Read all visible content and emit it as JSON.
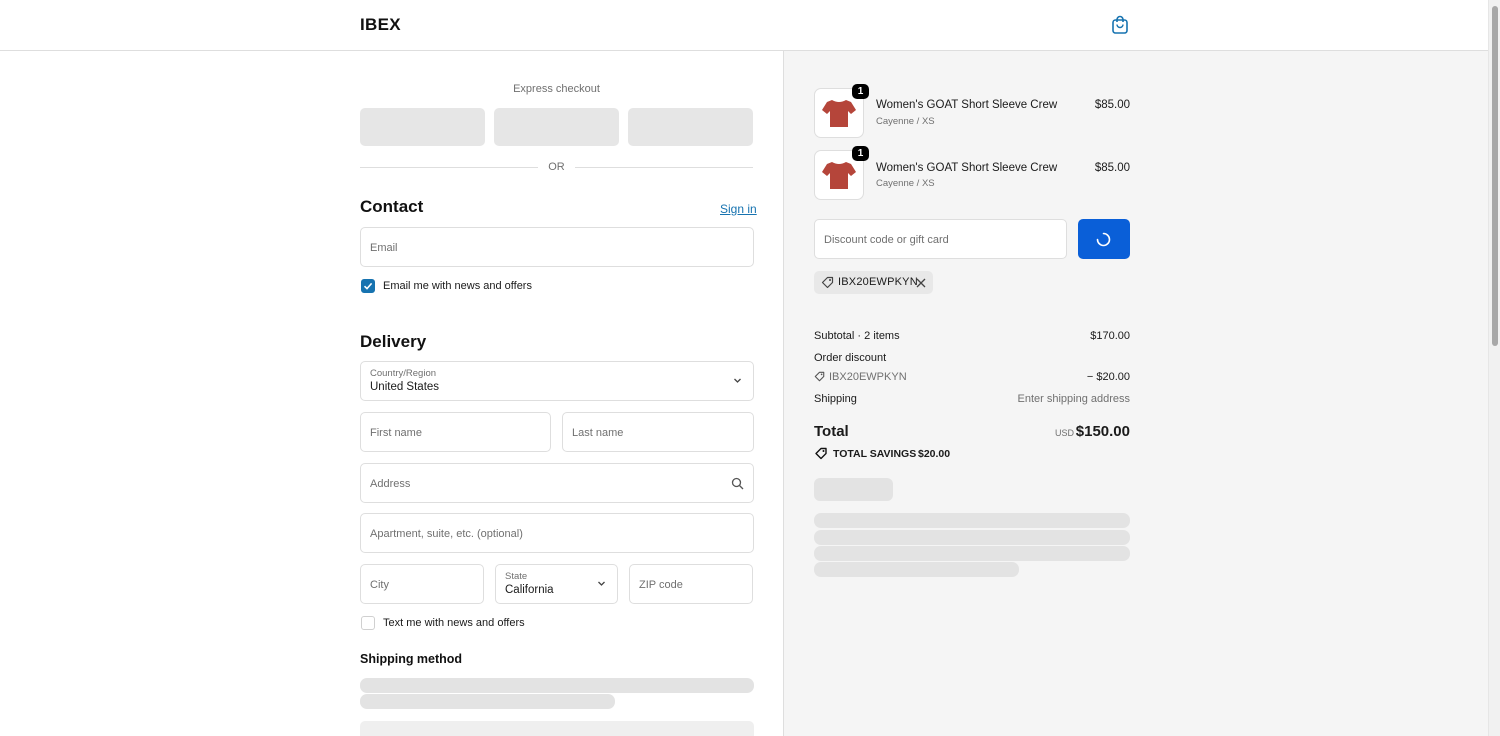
{
  "header": {
    "logo": "IBEX",
    "cart_icon": "shopping-bag-icon"
  },
  "express": {
    "label": "Express checkout",
    "or_label": "OR"
  },
  "contact": {
    "title": "Contact",
    "sign_in": "Sign in",
    "email_placeholder": "Email",
    "email_offers_label": "Email me with news and offers",
    "email_offers_checked": true
  },
  "delivery": {
    "title": "Delivery",
    "country_label": "Country/Region",
    "country_value": "United States",
    "first_name_placeholder": "First name",
    "last_name_placeholder": "Last name",
    "address_placeholder": "Address",
    "apartment_placeholder": "Apartment, suite, etc. (optional)",
    "city_placeholder": "City",
    "state_label": "State",
    "state_value": "California",
    "zip_placeholder": "ZIP code",
    "text_offers_label": "Text me with news and offers",
    "text_offers_checked": false
  },
  "shipping_method": {
    "title": "Shipping method"
  },
  "cart": {
    "items": [
      {
        "quantity": "1",
        "name": "Women's GOAT Short Sleeve Crew",
        "variant": "Cayenne / XS",
        "price": "$85.00"
      },
      {
        "quantity": "1",
        "name": "Women's GOAT Short Sleeve Crew",
        "variant": "Cayenne / XS",
        "price": "$85.00"
      }
    ],
    "discount_placeholder": "Discount code or gift card",
    "applied_code": "IBX20EWPKYN"
  },
  "totals": {
    "subtotal_label": "Subtotal · 2 items",
    "subtotal_value": "$170.00",
    "order_discount_label": "Order discount",
    "discount_code": "IBX20EWPKYN",
    "discount_value": "− $20.00",
    "shipping_label": "Shipping",
    "shipping_value": "Enter shipping address",
    "total_label": "Total",
    "currency": "USD",
    "total_value": "$150.00",
    "savings_label": "TOTAL SAVINGS",
    "savings_value": "$20.00"
  },
  "colors": {
    "accent": "#1773b0",
    "apply_button": "#0a5fd8",
    "product": "#b5453a"
  }
}
